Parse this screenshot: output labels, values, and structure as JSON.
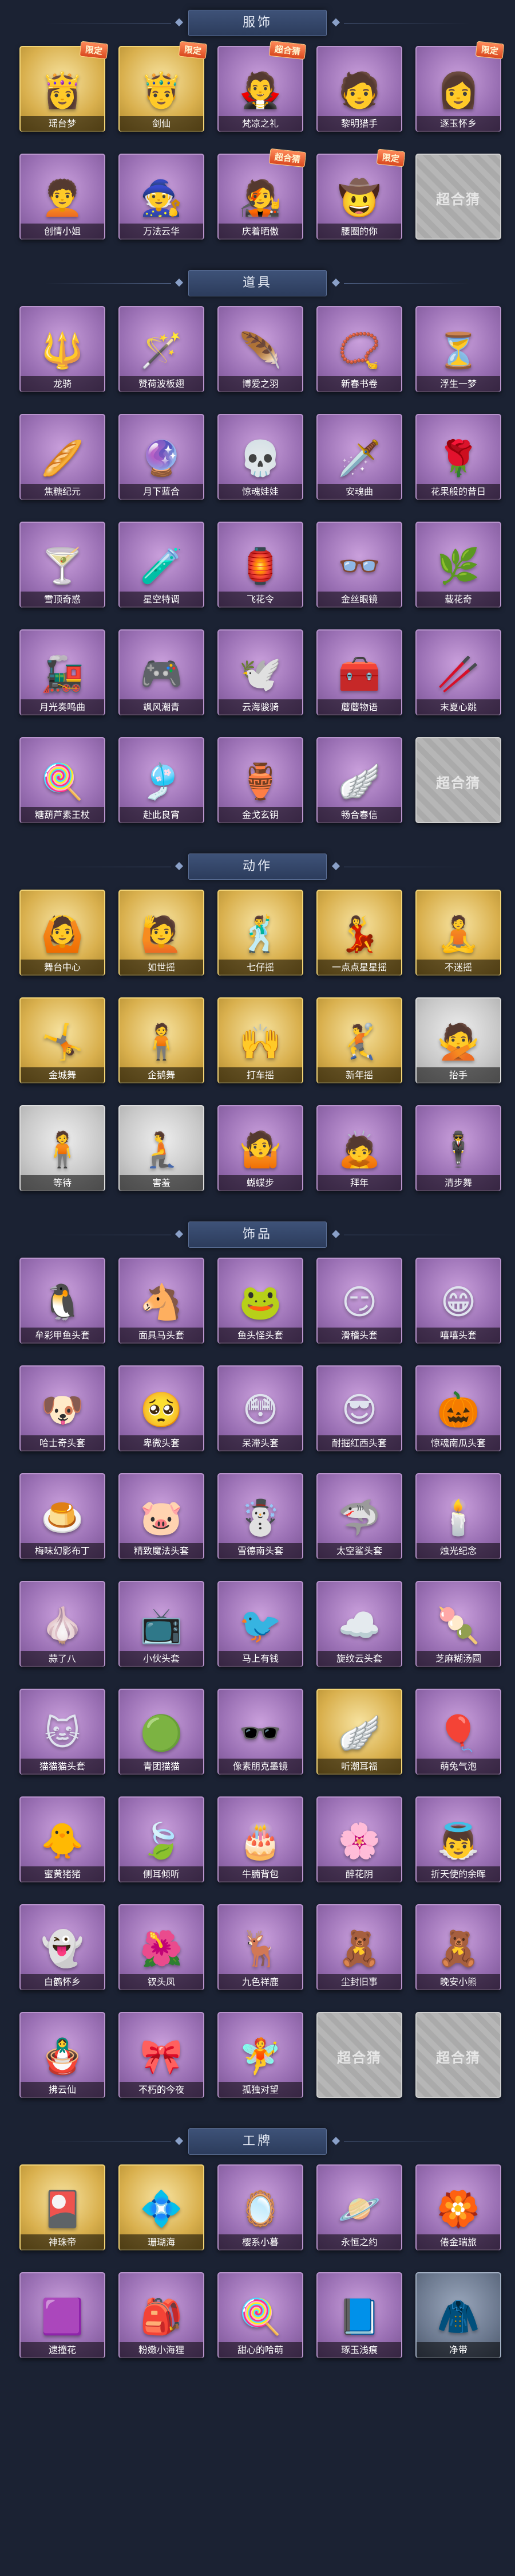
{
  "sections": [
    {
      "title": "服饰",
      "items": [
        {
          "label": "瑶台梦",
          "icon": "costume-icon",
          "glyph": "👸",
          "tone": "gold",
          "badge": "限定"
        },
        {
          "label": "剑仙",
          "icon": "costume-icon",
          "glyph": "🤴",
          "tone": "gold",
          "badge": "限定"
        },
        {
          "label": "梵凉之礼",
          "icon": "costume-icon",
          "glyph": "🧛",
          "tone": "purple",
          "badge": "超合猜"
        },
        {
          "label": "黎明猎手",
          "icon": "costume-icon",
          "glyph": "🧑",
          "tone": "purple",
          "badge": ""
        },
        {
          "label": "逐玉怀乡",
          "icon": "costume-icon",
          "glyph": "👩",
          "tone": "purple",
          "badge": "限定"
        },
        {
          "label": "创情小姐",
          "icon": "costume-icon",
          "glyph": "🧑‍🦱",
          "tone": "purple",
          "badge": ""
        },
        {
          "label": "万法云华",
          "icon": "costume-icon",
          "glyph": "🧙",
          "tone": "purple",
          "badge": ""
        },
        {
          "label": "庆着晒傲",
          "icon": "costume-icon",
          "glyph": "🧑‍🎤",
          "tone": "purple",
          "badge": "超合猜"
        },
        {
          "label": "腰圈的你",
          "icon": "costume-icon",
          "glyph": "🤠",
          "tone": "purple",
          "badge": "限定"
        },
        {
          "label": "",
          "icon": "placeholder-icon",
          "glyph": "",
          "tone": "placeholder",
          "badge": "",
          "ph": "超合猜"
        }
      ]
    },
    {
      "title": "道具",
      "items": [
        {
          "label": "龙骑",
          "icon": "prop-icon",
          "glyph": "🔱",
          "tone": "purple",
          "badge": ""
        },
        {
          "label": "赞荷波板翅",
          "icon": "prop-icon",
          "glyph": "🪄",
          "tone": "purple",
          "badge": ""
        },
        {
          "label": "博爱之羽",
          "icon": "prop-icon",
          "glyph": "🪶",
          "tone": "purple",
          "badge": ""
        },
        {
          "label": "新春书卷",
          "icon": "prop-icon",
          "glyph": "📿",
          "tone": "purple",
          "badge": ""
        },
        {
          "label": "浮生一梦",
          "icon": "prop-icon",
          "glyph": "⏳",
          "tone": "purple",
          "badge": ""
        },
        {
          "label": "焦糖纪元",
          "icon": "prop-icon",
          "glyph": "🥖",
          "tone": "purple",
          "badge": ""
        },
        {
          "label": "月下蓝合",
          "icon": "prop-icon",
          "glyph": "🔮",
          "tone": "purple",
          "badge": ""
        },
        {
          "label": "惊魂娃娃",
          "icon": "prop-icon",
          "glyph": "💀",
          "tone": "purple",
          "badge": ""
        },
        {
          "label": "安魂曲",
          "icon": "prop-icon",
          "glyph": "🗡️",
          "tone": "purple",
          "badge": ""
        },
        {
          "label": "花果般的昔日",
          "icon": "prop-icon",
          "glyph": "🌹",
          "tone": "purple",
          "badge": ""
        },
        {
          "label": "雪顶奇惑",
          "icon": "prop-icon",
          "glyph": "🍸",
          "tone": "purple",
          "badge": ""
        },
        {
          "label": "星空特调",
          "icon": "prop-icon",
          "glyph": "🧪",
          "tone": "purple",
          "badge": ""
        },
        {
          "label": "飞花令",
          "icon": "prop-icon",
          "glyph": "🏮",
          "tone": "purple",
          "badge": ""
        },
        {
          "label": "金丝眼镜",
          "icon": "prop-icon",
          "glyph": "👓",
          "tone": "purple",
          "badge": ""
        },
        {
          "label": "载花奇",
          "icon": "prop-icon",
          "glyph": "🌿",
          "tone": "purple",
          "badge": ""
        },
        {
          "label": "月光奏鸣曲",
          "icon": "prop-icon",
          "glyph": "🚂",
          "tone": "purple",
          "badge": ""
        },
        {
          "label": "飒风潮青",
          "icon": "prop-icon",
          "glyph": "🎮",
          "tone": "purple",
          "badge": ""
        },
        {
          "label": "云海骏骑",
          "icon": "prop-icon",
          "glyph": "🕊️",
          "tone": "purple",
          "badge": ""
        },
        {
          "label": "蘑蘑物语",
          "icon": "prop-icon",
          "glyph": "🧰",
          "tone": "purple",
          "badge": ""
        },
        {
          "label": "末夏心跳",
          "icon": "prop-icon",
          "glyph": "🥢",
          "tone": "purple",
          "badge": ""
        },
        {
          "label": "糖葫芦素王杖",
          "icon": "prop-icon",
          "glyph": "🍭",
          "tone": "purple",
          "badge": ""
        },
        {
          "label": "赴此良宵",
          "icon": "prop-icon",
          "glyph": "🎐",
          "tone": "purple",
          "badge": ""
        },
        {
          "label": "金戈玄钥",
          "icon": "prop-icon",
          "glyph": "🏺",
          "tone": "purple",
          "badge": ""
        },
        {
          "label": "畅合春信",
          "icon": "prop-icon",
          "glyph": "🪽",
          "tone": "purple",
          "badge": ""
        },
        {
          "label": "",
          "icon": "placeholder-icon",
          "glyph": "",
          "tone": "placeholder",
          "badge": "",
          "ph": "超合猜"
        }
      ]
    },
    {
      "title": "动作",
      "items": [
        {
          "label": "舞台中心",
          "icon": "emote-icon",
          "glyph": "🙆",
          "tone": "gold",
          "badge": ""
        },
        {
          "label": "如世摇",
          "icon": "emote-icon",
          "glyph": "🙋",
          "tone": "gold",
          "badge": ""
        },
        {
          "label": "七仔摇",
          "icon": "emote-icon",
          "glyph": "🕺",
          "tone": "gold",
          "badge": ""
        },
        {
          "label": "一点点星星摇",
          "icon": "emote-icon",
          "glyph": "💃",
          "tone": "gold",
          "badge": ""
        },
        {
          "label": "不迷摇",
          "icon": "emote-icon",
          "glyph": "🧘",
          "tone": "gold",
          "badge": ""
        },
        {
          "label": "金城舞",
          "icon": "emote-icon",
          "glyph": "🤸",
          "tone": "gold",
          "badge": ""
        },
        {
          "label": "企鹅舞",
          "icon": "emote-icon",
          "glyph": "🧍",
          "tone": "gold",
          "badge": ""
        },
        {
          "label": "打车摇",
          "icon": "emote-icon",
          "glyph": "🙌",
          "tone": "gold",
          "badge": ""
        },
        {
          "label": "新年摇",
          "icon": "emote-icon",
          "glyph": "🤾",
          "tone": "gold",
          "badge": ""
        },
        {
          "label": "抬手",
          "icon": "emote-icon",
          "glyph": "🙅",
          "tone": "gray",
          "badge": ""
        },
        {
          "label": "等待",
          "icon": "emote-icon",
          "glyph": "🧍",
          "tone": "gray",
          "badge": ""
        },
        {
          "label": "害羞",
          "icon": "emote-icon",
          "glyph": "🧎",
          "tone": "gray",
          "badge": ""
        },
        {
          "label": "蝴蝶步",
          "icon": "emote-icon",
          "glyph": "🤷",
          "tone": "purple",
          "badge": ""
        },
        {
          "label": "拜年",
          "icon": "emote-icon",
          "glyph": "🙇",
          "tone": "purple",
          "badge": ""
        },
        {
          "label": "清步舞",
          "icon": "emote-icon",
          "glyph": "🕴️",
          "tone": "purple",
          "badge": ""
        }
      ]
    },
    {
      "title": "饰品",
      "items": [
        {
          "label": "牟彩甲鱼头套",
          "icon": "accessory-icon",
          "glyph": "🐧",
          "tone": "purple",
          "badge": ""
        },
        {
          "label": "面具马头套",
          "icon": "accessory-icon",
          "glyph": "🐴",
          "tone": "purple",
          "badge": ""
        },
        {
          "label": "鱼头怪头套",
          "icon": "accessory-icon",
          "glyph": "🐸",
          "tone": "purple",
          "badge": ""
        },
        {
          "label": "滑稽头套",
          "icon": "accessory-icon",
          "glyph": "😏",
          "tone": "purple",
          "badge": ""
        },
        {
          "label": "嘻嘻头套",
          "icon": "accessory-icon",
          "glyph": "😁",
          "tone": "purple",
          "badge": ""
        },
        {
          "label": "哈士奇头套",
          "icon": "accessory-icon",
          "glyph": "🐶",
          "tone": "purple",
          "badge": ""
        },
        {
          "label": "卑微头套",
          "icon": "accessory-icon",
          "glyph": "🥺",
          "tone": "purple",
          "badge": ""
        },
        {
          "label": "呆滞头套",
          "icon": "accessory-icon",
          "glyph": "😳",
          "tone": "purple",
          "badge": ""
        },
        {
          "label": "耐掘红西头套",
          "icon": "accessory-icon",
          "glyph": "😎",
          "tone": "purple",
          "badge": ""
        },
        {
          "label": "惊魂南瓜头套",
          "icon": "accessory-icon",
          "glyph": "🎃",
          "tone": "purple",
          "badge": ""
        },
        {
          "label": "梅味幻影布丁",
          "icon": "accessory-icon",
          "glyph": "🍮",
          "tone": "purple",
          "badge": ""
        },
        {
          "label": "精致魔法头套",
          "icon": "accessory-icon",
          "glyph": "🐷",
          "tone": "purple",
          "badge": ""
        },
        {
          "label": "雪德南头套",
          "icon": "accessory-icon",
          "glyph": "☃️",
          "tone": "purple",
          "badge": ""
        },
        {
          "label": "太空鲨头套",
          "icon": "accessory-icon",
          "glyph": "🦈",
          "tone": "purple",
          "badge": ""
        },
        {
          "label": "烛光纪念",
          "icon": "accessory-icon",
          "glyph": "🕯️",
          "tone": "purple",
          "badge": ""
        },
        {
          "label": "蒜了八",
          "icon": "accessory-icon",
          "glyph": "🧄",
          "tone": "purple",
          "badge": ""
        },
        {
          "label": "小伙头套",
          "icon": "accessory-icon",
          "glyph": "📺",
          "tone": "purple",
          "badge": ""
        },
        {
          "label": "马上有钱",
          "icon": "accessory-icon",
          "glyph": "🐦",
          "tone": "purple",
          "badge": ""
        },
        {
          "label": "旋纹云头套",
          "icon": "accessory-icon",
          "glyph": "☁️",
          "tone": "purple",
          "badge": ""
        },
        {
          "label": "芝麻糊汤圆",
          "icon": "accessory-icon",
          "glyph": "🍡",
          "tone": "purple",
          "badge": ""
        },
        {
          "label": "猫猫猫头套",
          "icon": "accessory-icon",
          "glyph": "🐱",
          "tone": "purple",
          "badge": ""
        },
        {
          "label": "青团猫猫",
          "icon": "accessory-icon",
          "glyph": "🟢",
          "tone": "purple",
          "badge": ""
        },
        {
          "label": "像素朋克墨镜",
          "icon": "accessory-icon",
          "glyph": "🕶️",
          "tone": "purple",
          "badge": ""
        },
        {
          "label": "听潮耳福",
          "icon": "accessory-icon",
          "glyph": "🪽",
          "tone": "gold",
          "badge": ""
        },
        {
          "label": "萌兔气泡",
          "icon": "accessory-icon",
          "glyph": "🎈",
          "tone": "purple",
          "badge": ""
        },
        {
          "label": "蜜黄猪猪",
          "icon": "accessory-icon",
          "glyph": "🐥",
          "tone": "purple",
          "badge": ""
        },
        {
          "label": "侧耳倾听",
          "icon": "accessory-icon",
          "glyph": "🍃",
          "tone": "purple",
          "badge": ""
        },
        {
          "label": "牛腩背包",
          "icon": "accessory-icon",
          "glyph": "🎂",
          "tone": "purple",
          "badge": ""
        },
        {
          "label": "醉花阴",
          "icon": "accessory-icon",
          "glyph": "🌸",
          "tone": "purple",
          "badge": ""
        },
        {
          "label": "折天使的余晖",
          "icon": "accessory-icon",
          "glyph": "👼",
          "tone": "purple",
          "badge": ""
        },
        {
          "label": "白鹤怀乡",
          "icon": "accessory-icon",
          "glyph": "👻",
          "tone": "purple",
          "badge": ""
        },
        {
          "label": "钗头凤",
          "icon": "accessory-icon",
          "glyph": "🌺",
          "tone": "purple",
          "badge": ""
        },
        {
          "label": "九色祥鹿",
          "icon": "accessory-icon",
          "glyph": "🦌",
          "tone": "purple",
          "badge": ""
        },
        {
          "label": "尘封旧事",
          "icon": "accessory-icon",
          "glyph": "🧸",
          "tone": "purple",
          "badge": ""
        },
        {
          "label": "晚安小熊",
          "icon": "accessory-icon",
          "glyph": "🧸",
          "tone": "purple",
          "badge": ""
        },
        {
          "label": "拂云仙",
          "icon": "accessory-icon",
          "glyph": "🪆",
          "tone": "purple",
          "badge": ""
        },
        {
          "label": "不朽的今夜",
          "icon": "accessory-icon",
          "glyph": "🎀",
          "tone": "purple",
          "badge": ""
        },
        {
          "label": "孤独对望",
          "icon": "accessory-icon",
          "glyph": "🧚",
          "tone": "purple",
          "badge": ""
        },
        {
          "label": "",
          "icon": "placeholder-icon",
          "glyph": "",
          "tone": "placeholder",
          "badge": "",
          "ph": "超合猜"
        },
        {
          "label": "",
          "icon": "placeholder-icon",
          "glyph": "",
          "tone": "placeholder",
          "badge": "",
          "ph": "超合猜"
        }
      ]
    },
    {
      "title": "工牌",
      "items": [
        {
          "label": "神珠帝",
          "icon": "badge-card-icon",
          "glyph": "🎴",
          "tone": "gold",
          "badge": ""
        },
        {
          "label": "珊瑚海",
          "icon": "badge-card-icon",
          "glyph": "💠",
          "tone": "gold",
          "badge": ""
        },
        {
          "label": "樱系小暮",
          "icon": "badge-card-icon",
          "glyph": "🪞",
          "tone": "purple",
          "badge": ""
        },
        {
          "label": "永恒之约",
          "icon": "badge-card-icon",
          "glyph": "🪐",
          "tone": "purple",
          "badge": ""
        },
        {
          "label": "倦金瑞旅",
          "icon": "badge-card-icon",
          "glyph": "🏵️",
          "tone": "purple",
          "badge": ""
        },
        {
          "label": "逮撞花",
          "icon": "badge-card-icon",
          "glyph": "🟪",
          "tone": "purple",
          "badge": ""
        },
        {
          "label": "粉嫩小海狸",
          "icon": "badge-card-icon",
          "glyph": "🎒",
          "tone": "purple",
          "badge": ""
        },
        {
          "label": "甜心的哈萌",
          "icon": "badge-card-icon",
          "glyph": "🍭",
          "tone": "purple",
          "badge": ""
        },
        {
          "label": "琢玉浅痕",
          "icon": "badge-card-icon",
          "glyph": "📘",
          "tone": "purple",
          "badge": ""
        },
        {
          "label": "净带",
          "icon": "badge-card-icon",
          "glyph": "🧥",
          "tone": "dark",
          "badge": ""
        }
      ]
    }
  ]
}
